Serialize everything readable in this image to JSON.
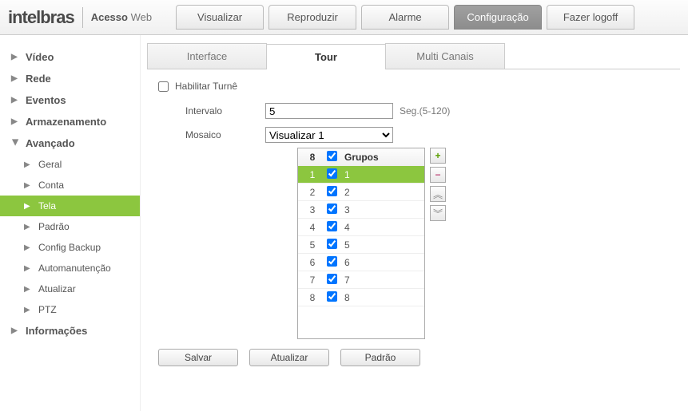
{
  "brand": {
    "name": "intelbras",
    "sub_bold": "Acesso",
    "sub_light": "Web"
  },
  "topnav": {
    "items": [
      "Visualizar",
      "Reproduzir",
      "Alarme",
      "Configuração",
      "Fazer logoff"
    ],
    "active_index": 3
  },
  "sidebar": {
    "top": [
      {
        "label": "Vídeo",
        "expanded": false
      },
      {
        "label": "Rede",
        "expanded": false
      },
      {
        "label": "Eventos",
        "expanded": false
      },
      {
        "label": "Armazenamento",
        "expanded": false
      },
      {
        "label": "Avançado",
        "expanded": true
      },
      {
        "label": "Informações",
        "expanded": false
      }
    ],
    "avancado_children": [
      {
        "label": "Geral",
        "active": false
      },
      {
        "label": "Conta",
        "active": false
      },
      {
        "label": "Tela",
        "active": true
      },
      {
        "label": "Padrão",
        "active": false
      },
      {
        "label": "Config Backup",
        "active": false
      },
      {
        "label": "Automanutenção",
        "active": false
      },
      {
        "label": "Atualizar",
        "active": false
      },
      {
        "label": "PTZ",
        "active": false
      }
    ]
  },
  "tabs": {
    "items": [
      "Interface",
      "Tour",
      "Multi Canais"
    ],
    "active_index": 1
  },
  "tour": {
    "enable_label": "Habilitar Turnê",
    "enable_checked": false,
    "interval_label": "Intervalo",
    "interval_value": "5",
    "interval_hint": "Seg.(5-120)",
    "mosaic_label": "Mosaico",
    "mosaic_selected": "Visualizar 1",
    "grid": {
      "header": {
        "count": "8",
        "checked": true,
        "label": "Grupos"
      },
      "rows": [
        {
          "idx": "1",
          "checked": true,
          "label": "1",
          "selected": true
        },
        {
          "idx": "2",
          "checked": true,
          "label": "2",
          "selected": false
        },
        {
          "idx": "3",
          "checked": true,
          "label": "3",
          "selected": false
        },
        {
          "idx": "4",
          "checked": true,
          "label": "4",
          "selected": false
        },
        {
          "idx": "5",
          "checked": true,
          "label": "5",
          "selected": false
        },
        {
          "idx": "6",
          "checked": true,
          "label": "6",
          "selected": false
        },
        {
          "idx": "7",
          "checked": true,
          "label": "7",
          "selected": false
        },
        {
          "idx": "8",
          "checked": true,
          "label": "8",
          "selected": false
        }
      ]
    },
    "buttons": {
      "save": "Salvar",
      "refresh": "Atualizar",
      "default": "Padrão"
    }
  }
}
